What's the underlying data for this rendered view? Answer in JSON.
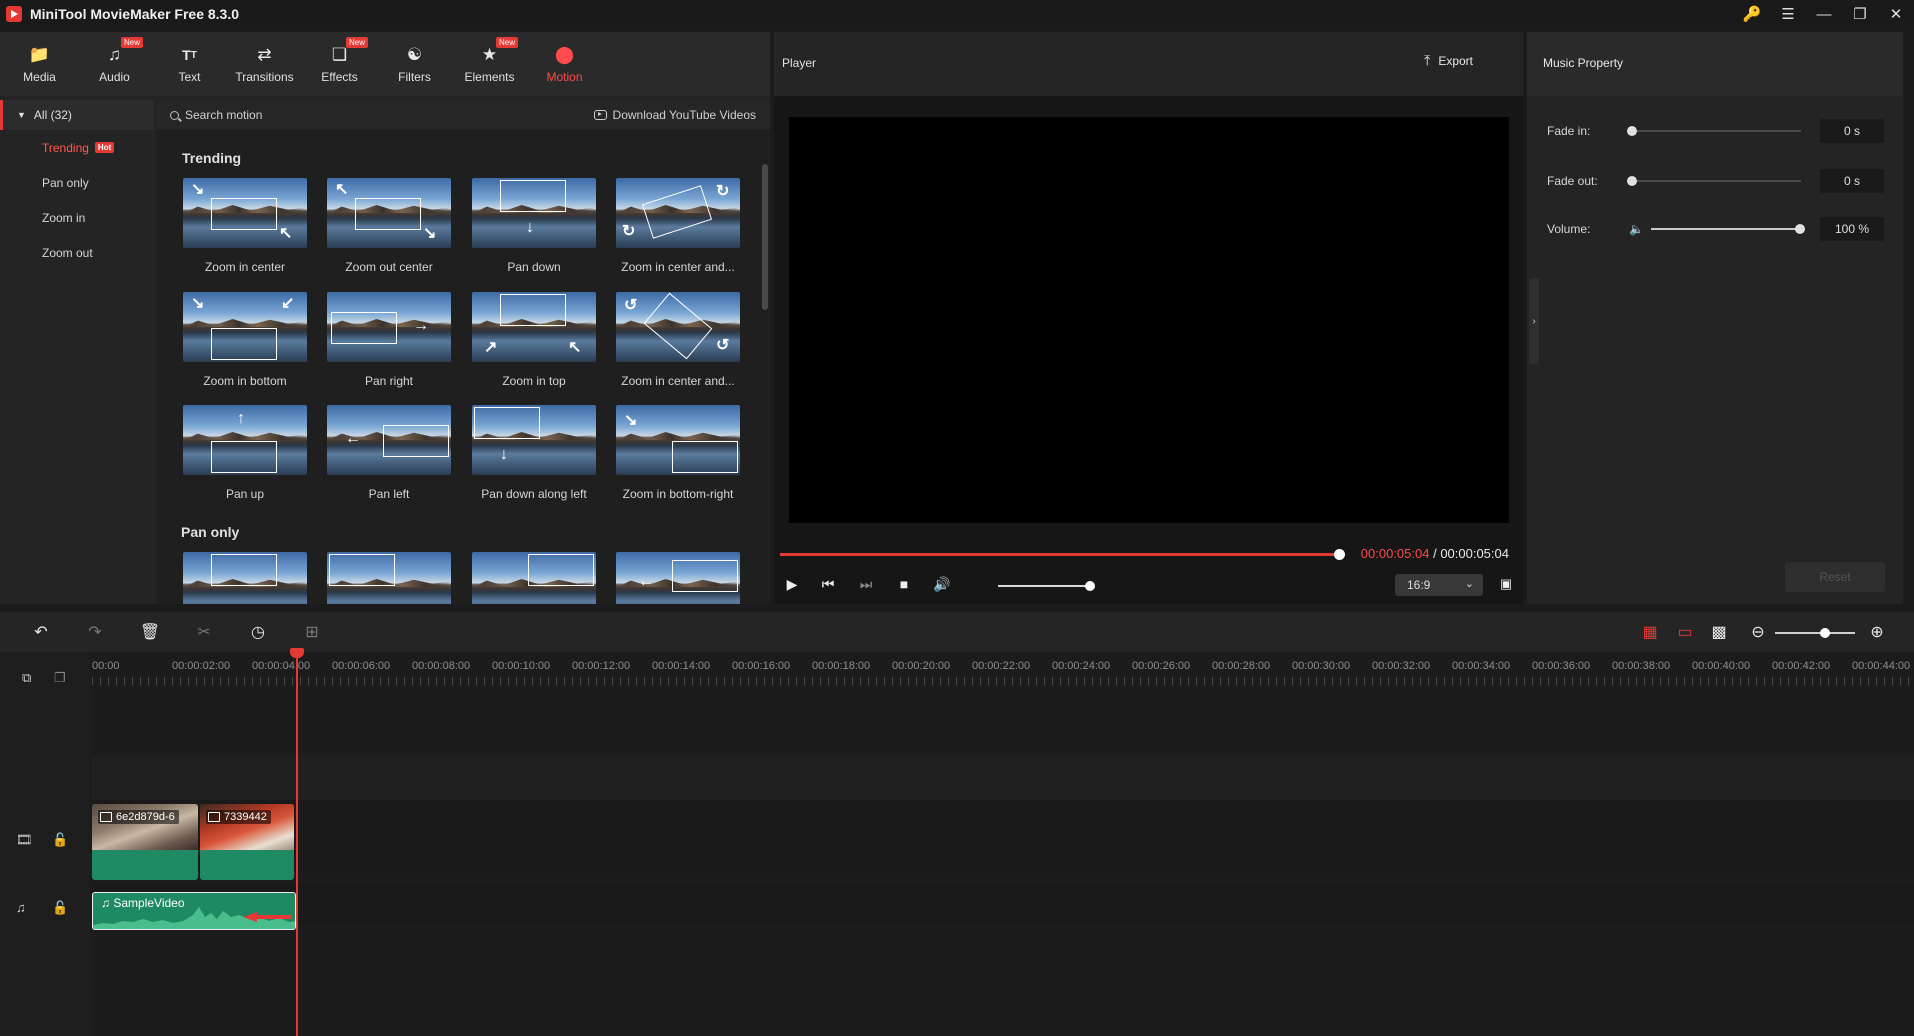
{
  "app": {
    "title": "MiniTool MovieMaker Free 8.3.0"
  },
  "tabs": [
    {
      "label": "Media",
      "icon": "folder-icon",
      "badge": ""
    },
    {
      "label": "Audio",
      "icon": "music-icon",
      "badge": "New"
    },
    {
      "label": "Text",
      "icon": "text-icon",
      "badge": ""
    },
    {
      "label": "Transitions",
      "icon": "transitions-icon",
      "badge": ""
    },
    {
      "label": "Effects",
      "icon": "effects-icon",
      "badge": "New"
    },
    {
      "label": "Filters",
      "icon": "filters-icon",
      "badge": ""
    },
    {
      "label": "Elements",
      "icon": "elements-icon",
      "badge": "New"
    },
    {
      "label": "Motion",
      "icon": "motion-icon",
      "badge": ""
    }
  ],
  "active_tab": "Motion",
  "categories": {
    "all": "All (32)",
    "items": [
      {
        "label": "Trending",
        "badge": "Hot"
      },
      {
        "label": "Pan only",
        "badge": ""
      },
      {
        "label": "Zoom in",
        "badge": ""
      },
      {
        "label": "Zoom out",
        "badge": ""
      }
    ]
  },
  "search": {
    "placeholder": "Search motion",
    "download_label": "Download YouTube Videos"
  },
  "sections": {
    "trending": "Trending",
    "pan_only": "Pan only"
  },
  "motions": [
    "Zoom in center",
    "Zoom out center",
    "Pan down",
    "Zoom in center and...",
    "Zoom in bottom",
    "Pan right",
    "Zoom in top",
    "Zoom in center and...",
    "Pan up",
    "Pan left",
    "Pan down along left",
    "Zoom in bottom-right"
  ],
  "player": {
    "title": "Player",
    "export_label": "Export",
    "current_time": "00:00:05:04",
    "separator": " / ",
    "total_time": "00:00:05:04",
    "progress": 1.0,
    "volume": 1.0,
    "aspect_ratio": "16:9"
  },
  "music_property": {
    "title": "Music Property",
    "fade_in_label": "Fade in:",
    "fade_in_value": "0 s",
    "fade_out_label": "Fade out:",
    "fade_out_value": "0 s",
    "volume_label": "Volume:",
    "volume_value": "100 %",
    "reset_label": "Reset"
  },
  "timeline": {
    "ruler": [
      "00:00",
      "00:00:02:00",
      "00:00:04:00",
      "00:00:06:00",
      "00:00:08:00",
      "00:00:10:00",
      "00:00:12:00",
      "00:00:14:00",
      "00:00:16:00",
      "00:00:18:00",
      "00:00:20:00",
      "00:00:22:00",
      "00:00:24:00",
      "00:00:26:00",
      "00:00:28:00",
      "00:00:30:00",
      "00:00:32:00",
      "00:00:34:00",
      "00:00:36:00",
      "00:00:38:00",
      "00:00:40:00",
      "00:00:42:00",
      "00:00:44:00"
    ],
    "video_clips": [
      "6e2d879d-6",
      "7339442"
    ],
    "audio_clip": "SampleVideo",
    "zoom_level": 0.62
  },
  "colors": {
    "accent": "#e53935",
    "clip_green": "#1f8a64"
  }
}
